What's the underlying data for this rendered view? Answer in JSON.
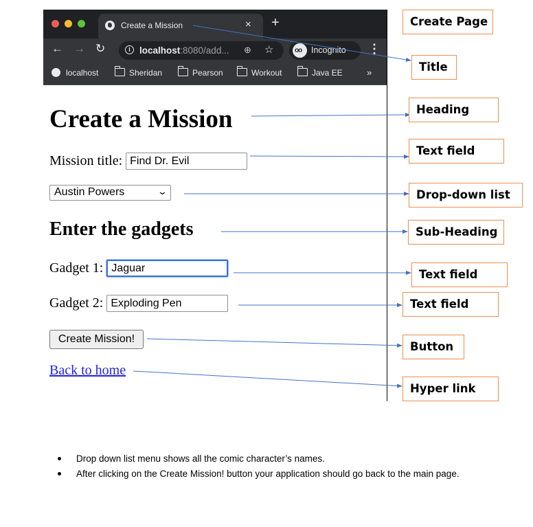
{
  "browser": {
    "tab_title": "Create a Mission",
    "tab_close": "×",
    "new_tab": "+",
    "url_host": "localhost",
    "url_rest": ":8080/add...",
    "incognito_label": "Incognito",
    "bookmarks": [
      "localhost",
      "Sheridan",
      "Pearson",
      "Workout",
      "Java EE"
    ],
    "bookmarks_overflow": "»"
  },
  "page": {
    "heading": "Create a Mission",
    "mission_title_label": "Mission title:",
    "mission_title_value": "Find Dr. Evil",
    "agent_selected": "Austin Powers",
    "subheading": "Enter the gadgets",
    "gadget1_label": "Gadget 1:",
    "gadget1_value": "Jaguar",
    "gadget2_label": "Gadget 2:",
    "gadget2_value": "Exploding Pen",
    "submit_label": "Create Mission!",
    "back_link": "Back to home"
  },
  "callouts": {
    "create_page": "Create Page",
    "title": "Title",
    "heading": "Heading",
    "text_field_1": "Text field",
    "dropdown": "Drop-down list",
    "subheading": "Sub-Heading",
    "text_field_2": "Text field",
    "text_field_3": "Text field",
    "button": "Button",
    "hyperlink": "Hyper link"
  },
  "colors": {
    "callout_border": "#ec8f4e",
    "arrow": "#4472c4",
    "focus_ring": "#3a73d6"
  },
  "notes": [
    "Drop down list menu shows all the comic character’s names.",
    "After clicking on the Create Mission! button your application should go back to the main page."
  ]
}
